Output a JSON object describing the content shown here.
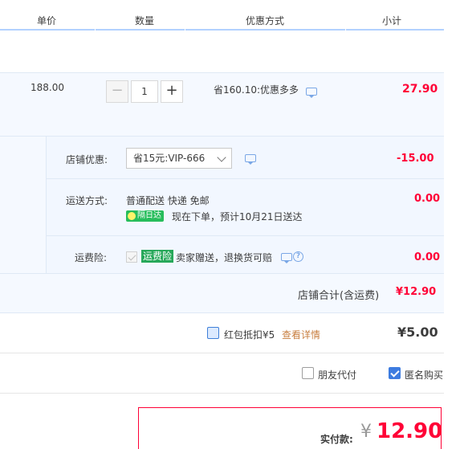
{
  "header": {
    "col_unit_price": "单价",
    "col_quantity": "数量",
    "col_discount_method": "优惠方式",
    "col_subtotal": "小计"
  },
  "item": {
    "unit_price": "188.00",
    "quantity": "1",
    "minus_label": "−",
    "plus_label": "+",
    "discount": "省160.10:优惠多多",
    "subtotal": "27.90"
  },
  "shop_discount": {
    "label": "店铺优惠:",
    "selected": "省15元:VIP-666",
    "amount": "-15.00"
  },
  "shipping": {
    "label": "运送方式:",
    "method": "普通配送 快递 免邮",
    "badge": "隔日达",
    "note": "现在下单，预计10月21日送达",
    "amount": "0.00"
  },
  "shipping_insurance": {
    "label": "运费险:",
    "tag": "运费险",
    "text": "卖家赠送，退换货可赔",
    "amount": "0.00"
  },
  "shop_total": {
    "label": "店铺合计(含运费)",
    "amount": "¥12.90"
  },
  "red_packet": {
    "label": "红包抵扣¥5",
    "link": "查看详情",
    "amount": "¥5.00"
  },
  "options": {
    "friend_pay": "朋友代付",
    "anonymous": "匿名购买"
  },
  "payment": {
    "label": "实付款:",
    "currency": "¥",
    "amount": "12.90"
  },
  "colors": {
    "accent_red": "#ff0036",
    "accent_blue": "#3d7ce0",
    "link_orange": "#c87f41",
    "green_badge": "#27bd5c"
  }
}
